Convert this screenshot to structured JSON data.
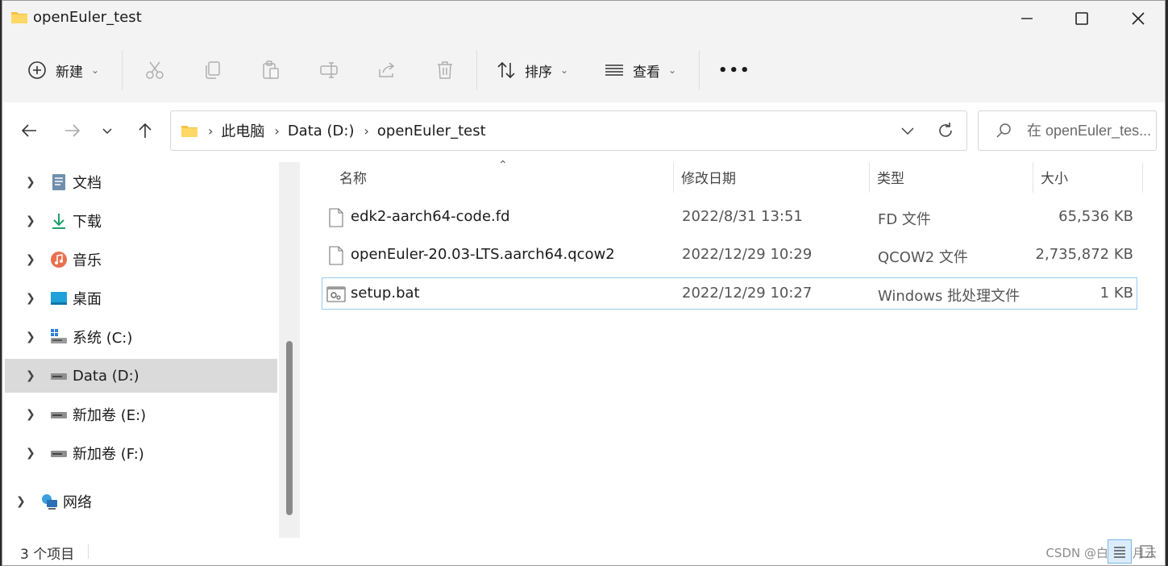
{
  "window": {
    "title": "openEuler_test",
    "minimize_icon": "minimize-icon",
    "maximize_icon": "maximize-icon",
    "close_icon": "close-icon"
  },
  "toolbar": {
    "new_label": "新建",
    "sort_label": "排序",
    "view_label": "查看",
    "more_label": "•••",
    "disabled_actions": [
      "cut-icon",
      "copy-icon",
      "paste-icon",
      "rename-icon",
      "share-icon",
      "delete-icon"
    ]
  },
  "address": {
    "crumbs": [
      "此电脑",
      "Data (D:)",
      "openEuler_test"
    ]
  },
  "search": {
    "placeholder": "在 openEuler_tes..."
  },
  "sidebar": {
    "items": [
      {
        "label": "文档",
        "icon": "documents-icon"
      },
      {
        "label": "下载",
        "icon": "download-icon"
      },
      {
        "label": "音乐",
        "icon": "music-icon"
      },
      {
        "label": "桌面",
        "icon": "desktop-icon"
      },
      {
        "label": "系统 (C:)",
        "icon": "system-drive-icon"
      },
      {
        "label": "Data (D:)",
        "icon": "drive-icon",
        "selected": true
      },
      {
        "label": "新加卷 (E:)",
        "icon": "drive-icon"
      },
      {
        "label": "新加卷 (F:)",
        "icon": "drive-icon"
      },
      {
        "label": "网络",
        "icon": "network-icon"
      }
    ]
  },
  "columns": {
    "name": "名称",
    "modified": "修改日期",
    "type": "类型",
    "size": "大小"
  },
  "files": [
    {
      "name": "edk2-aarch64-code.fd",
      "modified": "2022/8/31 13:51",
      "type": "FD 文件",
      "size": "65,536 KB",
      "icon": "file-icon"
    },
    {
      "name": "openEuler-20.03-LTS.aarch64.qcow2",
      "modified": "2022/12/29 10:29",
      "type": "QCOW2 文件",
      "size": "2,735,872 KB",
      "icon": "file-icon"
    },
    {
      "name": "setup.bat",
      "modified": "2022/12/29 10:27",
      "type": "Windows 批处理文件",
      "size": "1 KB",
      "icon": "batch-file-icon",
      "selected": true
    }
  ],
  "status": {
    "count_text": "3 个项目",
    "watermark": "CSDN @白云明月云"
  },
  "colors": {
    "accent": "#0067c0",
    "folder": "#f5c242",
    "selection_border": "#99c9ef",
    "sidebar_selected": "#dadada"
  }
}
